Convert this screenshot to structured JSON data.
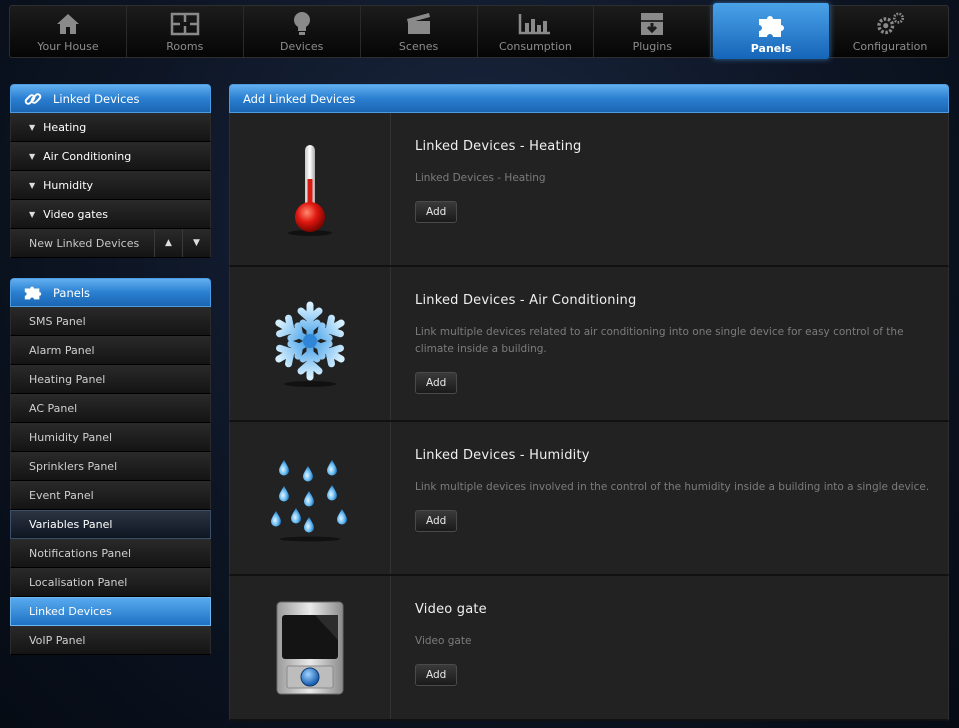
{
  "topnav": {
    "items": [
      {
        "label": "Your House",
        "icon": "house-icon"
      },
      {
        "label": "Rooms",
        "icon": "rooms-icon"
      },
      {
        "label": "Devices",
        "icon": "bulb-icon"
      },
      {
        "label": "Scenes",
        "icon": "clapper-icon"
      },
      {
        "label": "Consumption",
        "icon": "chart-icon"
      },
      {
        "label": "Plugins",
        "icon": "plugin-box-icon"
      },
      {
        "label": "Panels",
        "icon": "puzzle-icon"
      },
      {
        "label": "Configuration",
        "icon": "gears-icon"
      }
    ],
    "active_index": 6
  },
  "sidebar": {
    "linked": {
      "title": "Linked Devices",
      "items": [
        "Heating",
        "Air Conditioning",
        "Humidity",
        "Video gates"
      ],
      "new_label": "New Linked Devices"
    },
    "panels": {
      "title": "Panels",
      "items": [
        "SMS Panel",
        "Alarm Panel",
        "Heating Panel",
        "AC Panel",
        "Humidity Panel",
        "Sprinklers Panel",
        "Event Panel",
        "Variables Panel",
        "Notifications Panel",
        "Localisation Panel",
        "Linked Devices",
        "VoIP Panel"
      ],
      "hover_item": "Variables Panel",
      "active_item": "Linked Devices"
    }
  },
  "main": {
    "title": "Add Linked Devices",
    "cards": [
      {
        "title": "Linked Devices - Heating",
        "desc": "Linked Devices - Heating",
        "button": "Add",
        "icon": "thermometer-icon"
      },
      {
        "title": "Linked Devices - Air Conditioning",
        "desc": "Link multiple devices related to air conditioning into one single device for easy control of the climate inside a building.",
        "button": "Add",
        "icon": "snowflake-icon"
      },
      {
        "title": "Linked Devices - Humidity",
        "desc": "Link multiple devices involved in the control of the humidity inside a building into a single device.",
        "button": "Add",
        "icon": "water-drops-icon"
      },
      {
        "title": "Video gate",
        "desc": "Video gate",
        "button": "Add",
        "icon": "intercom-icon"
      }
    ]
  }
}
